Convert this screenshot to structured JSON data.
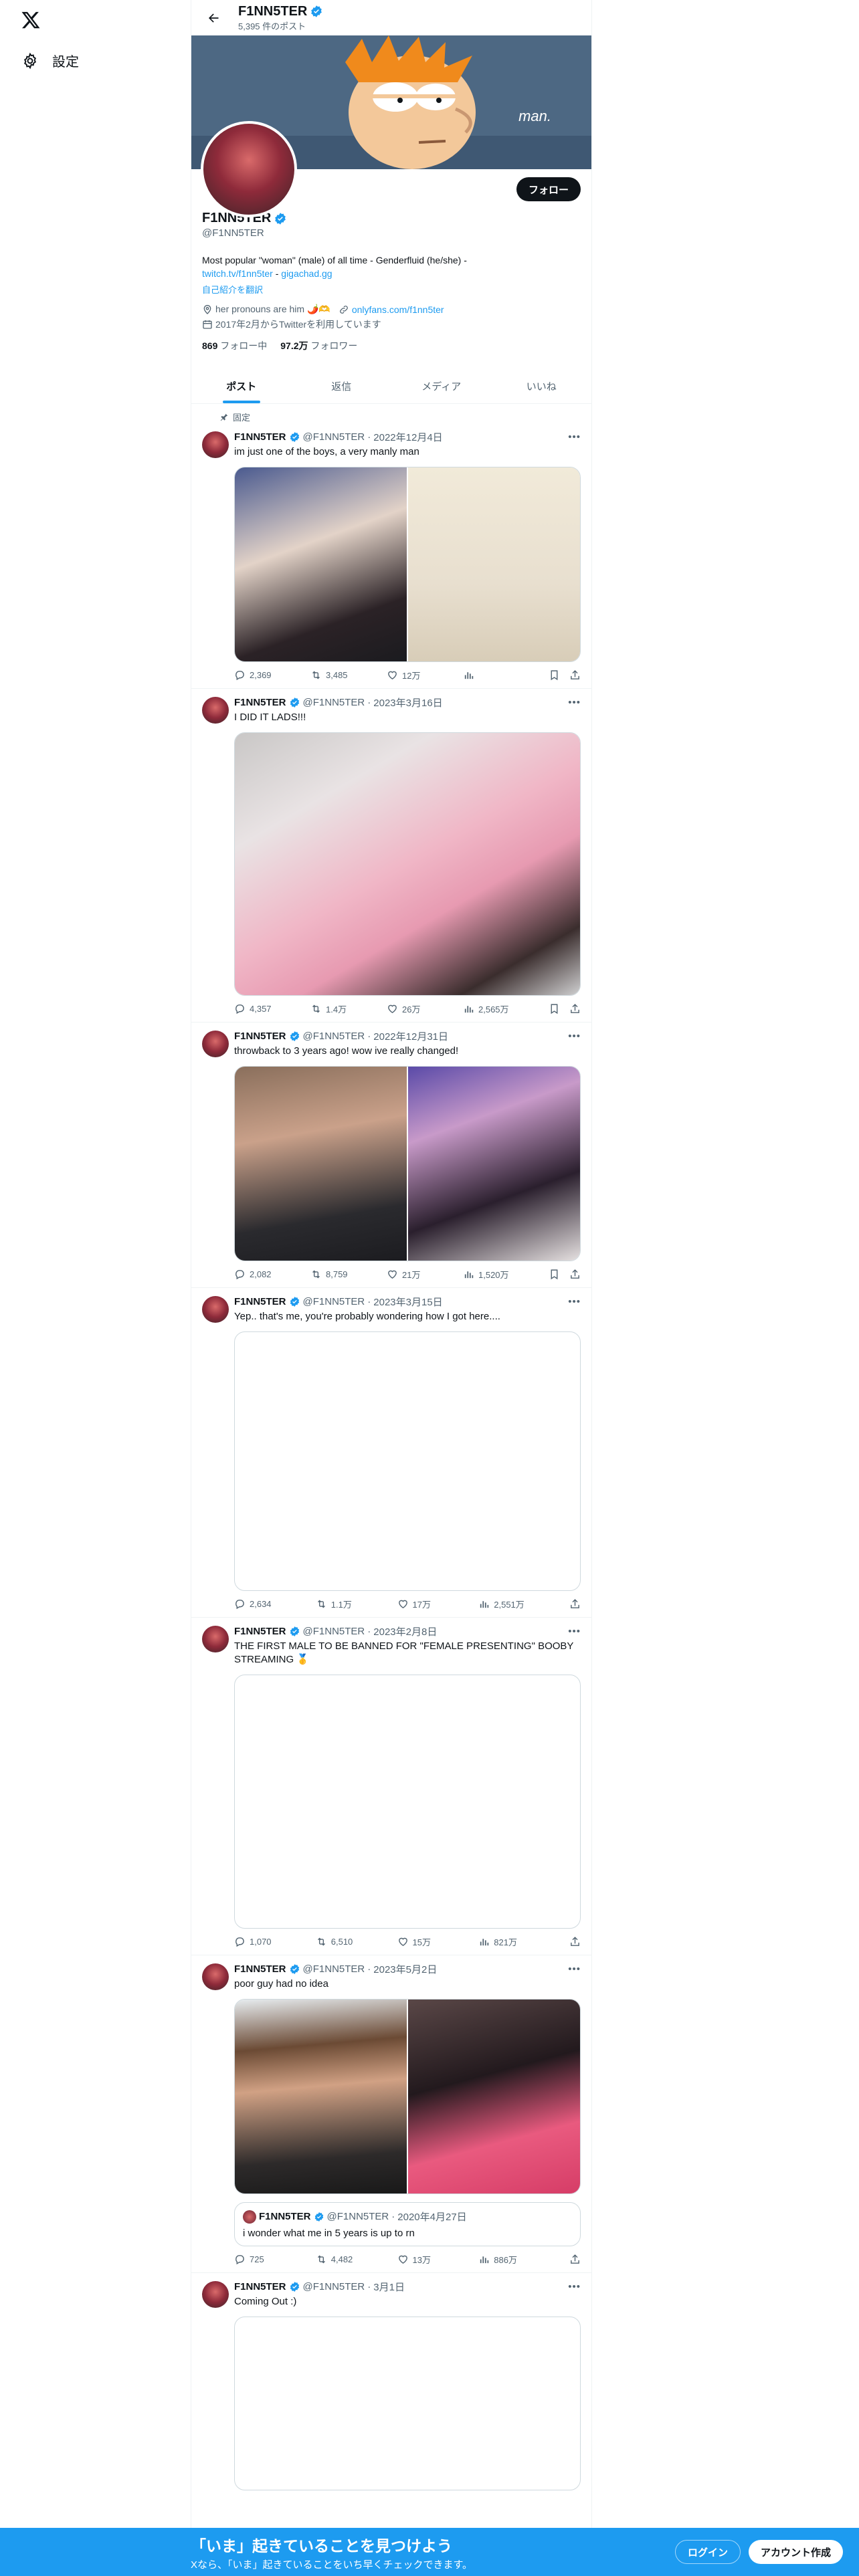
{
  "nav": {
    "settings_label": "設定"
  },
  "header": {
    "name": "F1NN5TER",
    "post_count": "5,395 件のポスト"
  },
  "banner": {
    "caption": "man."
  },
  "profile": {
    "follow_label": "フォロー",
    "display_name": "F1NN5TER",
    "handle": "@F1NN5TER",
    "bio_line1": "Most popular \"woman\" (male) of all time - Genderfluid (he/she) -",
    "bio_link1": "twitch.tv/f1nn5ter",
    "bio_sep": " - ",
    "bio_link2": "gigachad.gg",
    "translate": "自己紹介を翻訳",
    "location": "her pronouns are him 🌶️🫶",
    "website": "onlyfans.com/f1nn5ter",
    "joined": "2017年2月からTwitterを利用しています",
    "following_count": "869",
    "following_label": "フォロー中",
    "followers_count": "97.2万",
    "followers_label": "フォロワー"
  },
  "tabs": [
    "ポスト",
    "返信",
    "メディア",
    "いいね"
  ],
  "pinned_label": "固定",
  "tweets": [
    {
      "name": "F1NN5TER",
      "handle": "@F1NN5TER",
      "date": "2022年12月4日",
      "text": "im just one of the boys, a very manly man",
      "replies": "2,369",
      "retweets": "3,485",
      "likes": "12万",
      "views": ""
    },
    {
      "name": "F1NN5TER",
      "handle": "@F1NN5TER",
      "date": "2023年3月16日",
      "text": "I DID IT LADS!!!",
      "replies": "4,357",
      "retweets": "1.4万",
      "likes": "26万",
      "views": "2,565万"
    },
    {
      "name": "F1NN5TER",
      "handle": "@F1NN5TER",
      "date": "2022年12月31日",
      "text": "throwback to 3 years ago! wow ive really changed!",
      "replies": "2,082",
      "retweets": "8,759",
      "likes": "21万",
      "views": "1,520万"
    },
    {
      "name": "F1NN5TER",
      "handle": "@F1NN5TER",
      "date": "2023年3月15日",
      "text": "Yep.. that's me, you're probably wondering how I got here....",
      "replies": "2,634",
      "retweets": "1.1万",
      "likes": "17万",
      "views": "2,551万"
    },
    {
      "name": "F1NN5TER",
      "handle": "@F1NN5TER",
      "date": "2023年2月8日",
      "text": "THE FIRST MALE TO BE BANNED FOR \"FEMALE PRESENTING\" BOOBY STREAMING 🥇",
      "replies": "1,070",
      "retweets": "6,510",
      "likes": "15万",
      "views": "821万"
    },
    {
      "name": "F1NN5TER",
      "handle": "@F1NN5TER",
      "date": "2023年5月2日",
      "text": "poor guy had no idea",
      "replies": "725",
      "retweets": "4,482",
      "likes": "13万",
      "views": "886万",
      "quote": {
        "name": "F1NN5TER",
        "handle": "@F1NN5TER",
        "date": "2020年4月27日",
        "text": "i wonder what me in 5 years is up to rn"
      }
    },
    {
      "name": "F1NN5TER",
      "handle": "@F1NN5TER",
      "date": "3月1日",
      "text": "Coming Out :)"
    }
  ],
  "bottombar": {
    "title": "「いま」起きていることを見つけよう",
    "subtitle": "Xなら、「いま」起きていることをいち早くチェックできます。",
    "login": "ログイン",
    "signup": "アカウント作成"
  },
  "colors": {
    "accent": "#1d9bf0",
    "text": "#0f1419",
    "muted": "#536471",
    "border": "#eff3f4"
  }
}
